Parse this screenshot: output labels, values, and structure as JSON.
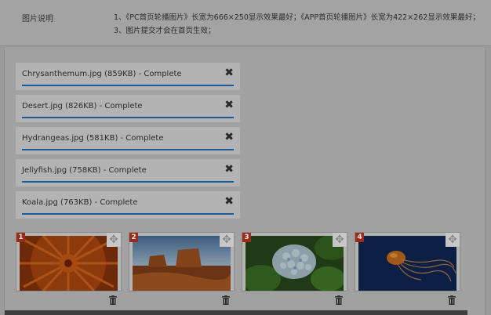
{
  "description": {
    "label": "图片说明",
    "line1": "1、《PC首页轮播图片》长宽为666×250显示效果最好；《APP首页轮播图片》长宽为422×262显示效果最好；",
    "line2": "3、图片提交才会在首页生效；"
  },
  "files": [
    {
      "name": "Chrysanthemum.jpg (859KB) - Complete"
    },
    {
      "name": "Desert.jpg (826KB) - Complete"
    },
    {
      "name": "Hydrangeas.jpg (581KB) - Complete"
    },
    {
      "name": "Jellyfish.jpg (758KB) - Complete"
    },
    {
      "name": "Koala.jpg (763KB) - Complete"
    }
  ],
  "close_glyph": "✖",
  "thumbnails": [
    {
      "number": "1",
      "subject": "chrysanthemum"
    },
    {
      "number": "2",
      "subject": "desert"
    },
    {
      "number": "3",
      "subject": "hydrangeas"
    },
    {
      "number": "4",
      "subject": "jellyfish"
    }
  ],
  "icons": {
    "move": "move-icon",
    "delete": "trash-icon"
  }
}
